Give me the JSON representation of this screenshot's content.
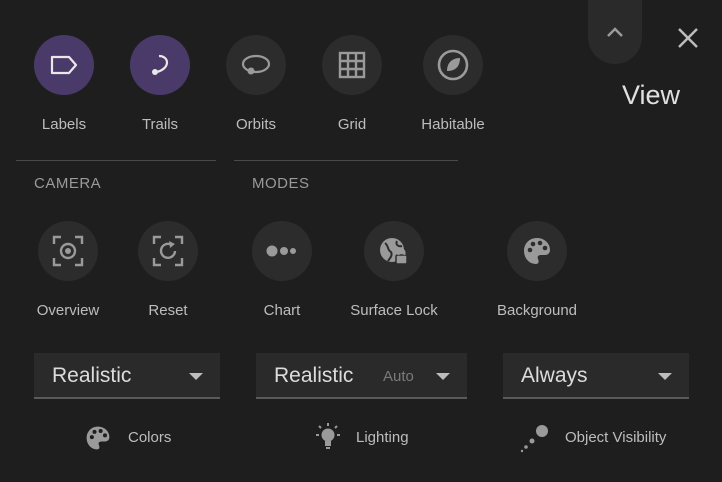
{
  "title": "View",
  "toggles": [
    {
      "label": "Labels",
      "icon": "label-icon",
      "active": true
    },
    {
      "label": "Trails",
      "icon": "trail-icon",
      "active": true
    },
    {
      "label": "Orbits",
      "icon": "orbit-icon",
      "active": false
    },
    {
      "label": "Grid",
      "icon": "grid-icon",
      "active": false
    },
    {
      "label": "Habitable",
      "icon": "leaf-icon",
      "active": false
    }
  ],
  "camera": {
    "heading": "CAMERA",
    "buttons": [
      {
        "label": "Overview",
        "icon": "target-focus-icon"
      },
      {
        "label": "Reset",
        "icon": "reset-icon"
      }
    ]
  },
  "modes": {
    "heading": "MODES",
    "buttons": [
      {
        "label": "Chart",
        "icon": "dots-icon"
      },
      {
        "label": "Surface Lock",
        "icon": "globe-lock-icon"
      },
      {
        "label": "Background",
        "icon": "palette-icon"
      }
    ]
  },
  "selects": [
    {
      "value": "Realistic",
      "sub": "",
      "footer": "Colors",
      "footer_icon": "palette-icon"
    },
    {
      "value": "Realistic",
      "sub": "Auto",
      "footer": "Lighting",
      "footer_icon": "lightbulb-icon"
    },
    {
      "value": "Always",
      "sub": "",
      "footer": "Object Visibility",
      "footer_icon": "visibility-icon"
    }
  ],
  "colors": {
    "active": "#4a3a6a",
    "button": "#2c2c2c",
    "background": "#1e1e1e"
  }
}
